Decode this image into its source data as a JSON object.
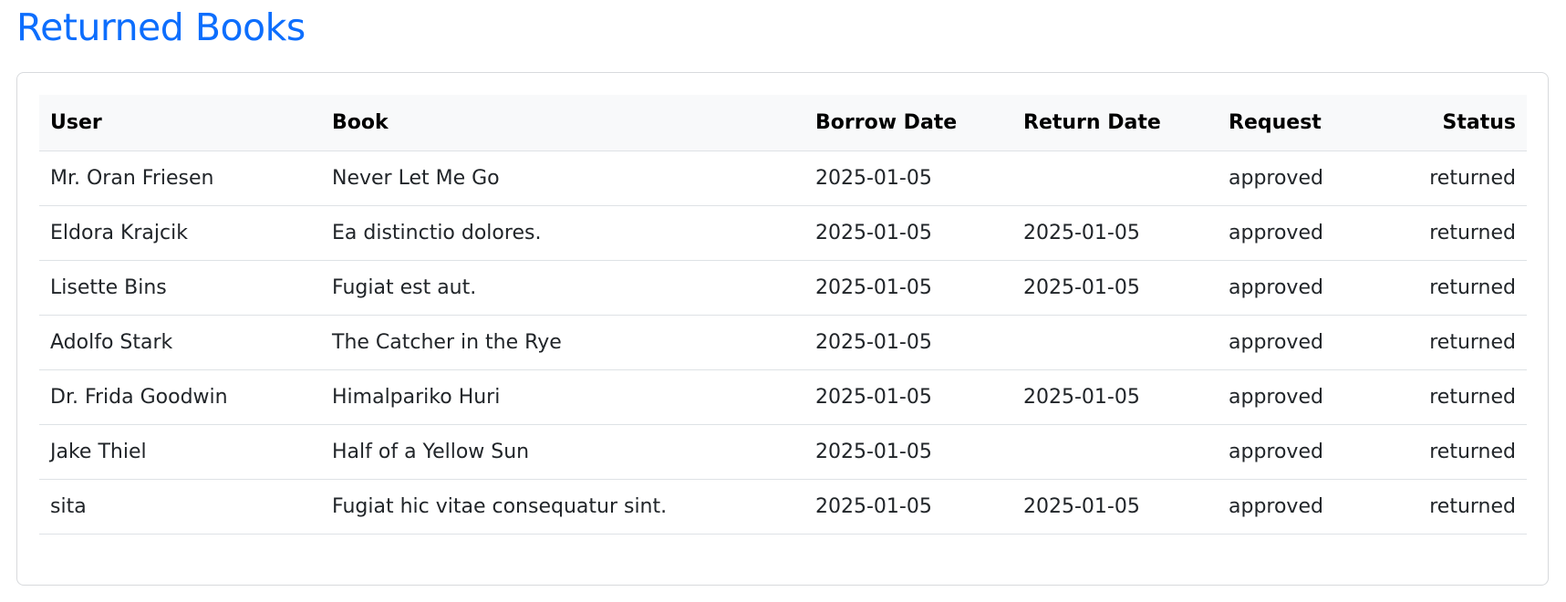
{
  "page": {
    "title": "Returned Books",
    "accent_color": "#0d6efd"
  },
  "table": {
    "headers": {
      "user": "User",
      "book": "Book",
      "borrow_date": "Borrow Date",
      "return_date": "Return Date",
      "request": "Request",
      "status": "Status"
    },
    "rows": [
      {
        "user": "Mr. Oran Friesen",
        "book": "Never Let Me Go",
        "borrow_date": "2025-01-05",
        "return_date": "",
        "request": "approved",
        "status": "returned"
      },
      {
        "user": "Eldora Krajcik",
        "book": "Ea distinctio dolores.",
        "borrow_date": "2025-01-05",
        "return_date": "2025-01-05",
        "request": "approved",
        "status": "returned"
      },
      {
        "user": "Lisette Bins",
        "book": "Fugiat est aut.",
        "borrow_date": "2025-01-05",
        "return_date": "2025-01-05",
        "request": "approved",
        "status": "returned"
      },
      {
        "user": "Adolfo Stark",
        "book": "The Catcher in the Rye",
        "borrow_date": "2025-01-05",
        "return_date": "",
        "request": "approved",
        "status": "returned"
      },
      {
        "user": "Dr. Frida Goodwin",
        "book": "Himalpariko Huri",
        "borrow_date": "2025-01-05",
        "return_date": "2025-01-05",
        "request": "approved",
        "status": "returned"
      },
      {
        "user": "Jake Thiel",
        "book": "Half of a Yellow Sun",
        "borrow_date": "2025-01-05",
        "return_date": "",
        "request": "approved",
        "status": "returned"
      },
      {
        "user": "sita",
        "book": "Fugiat hic vitae consequatur sint.",
        "borrow_date": "2025-01-05",
        "return_date": "2025-01-05",
        "request": "approved",
        "status": "returned"
      }
    ]
  }
}
